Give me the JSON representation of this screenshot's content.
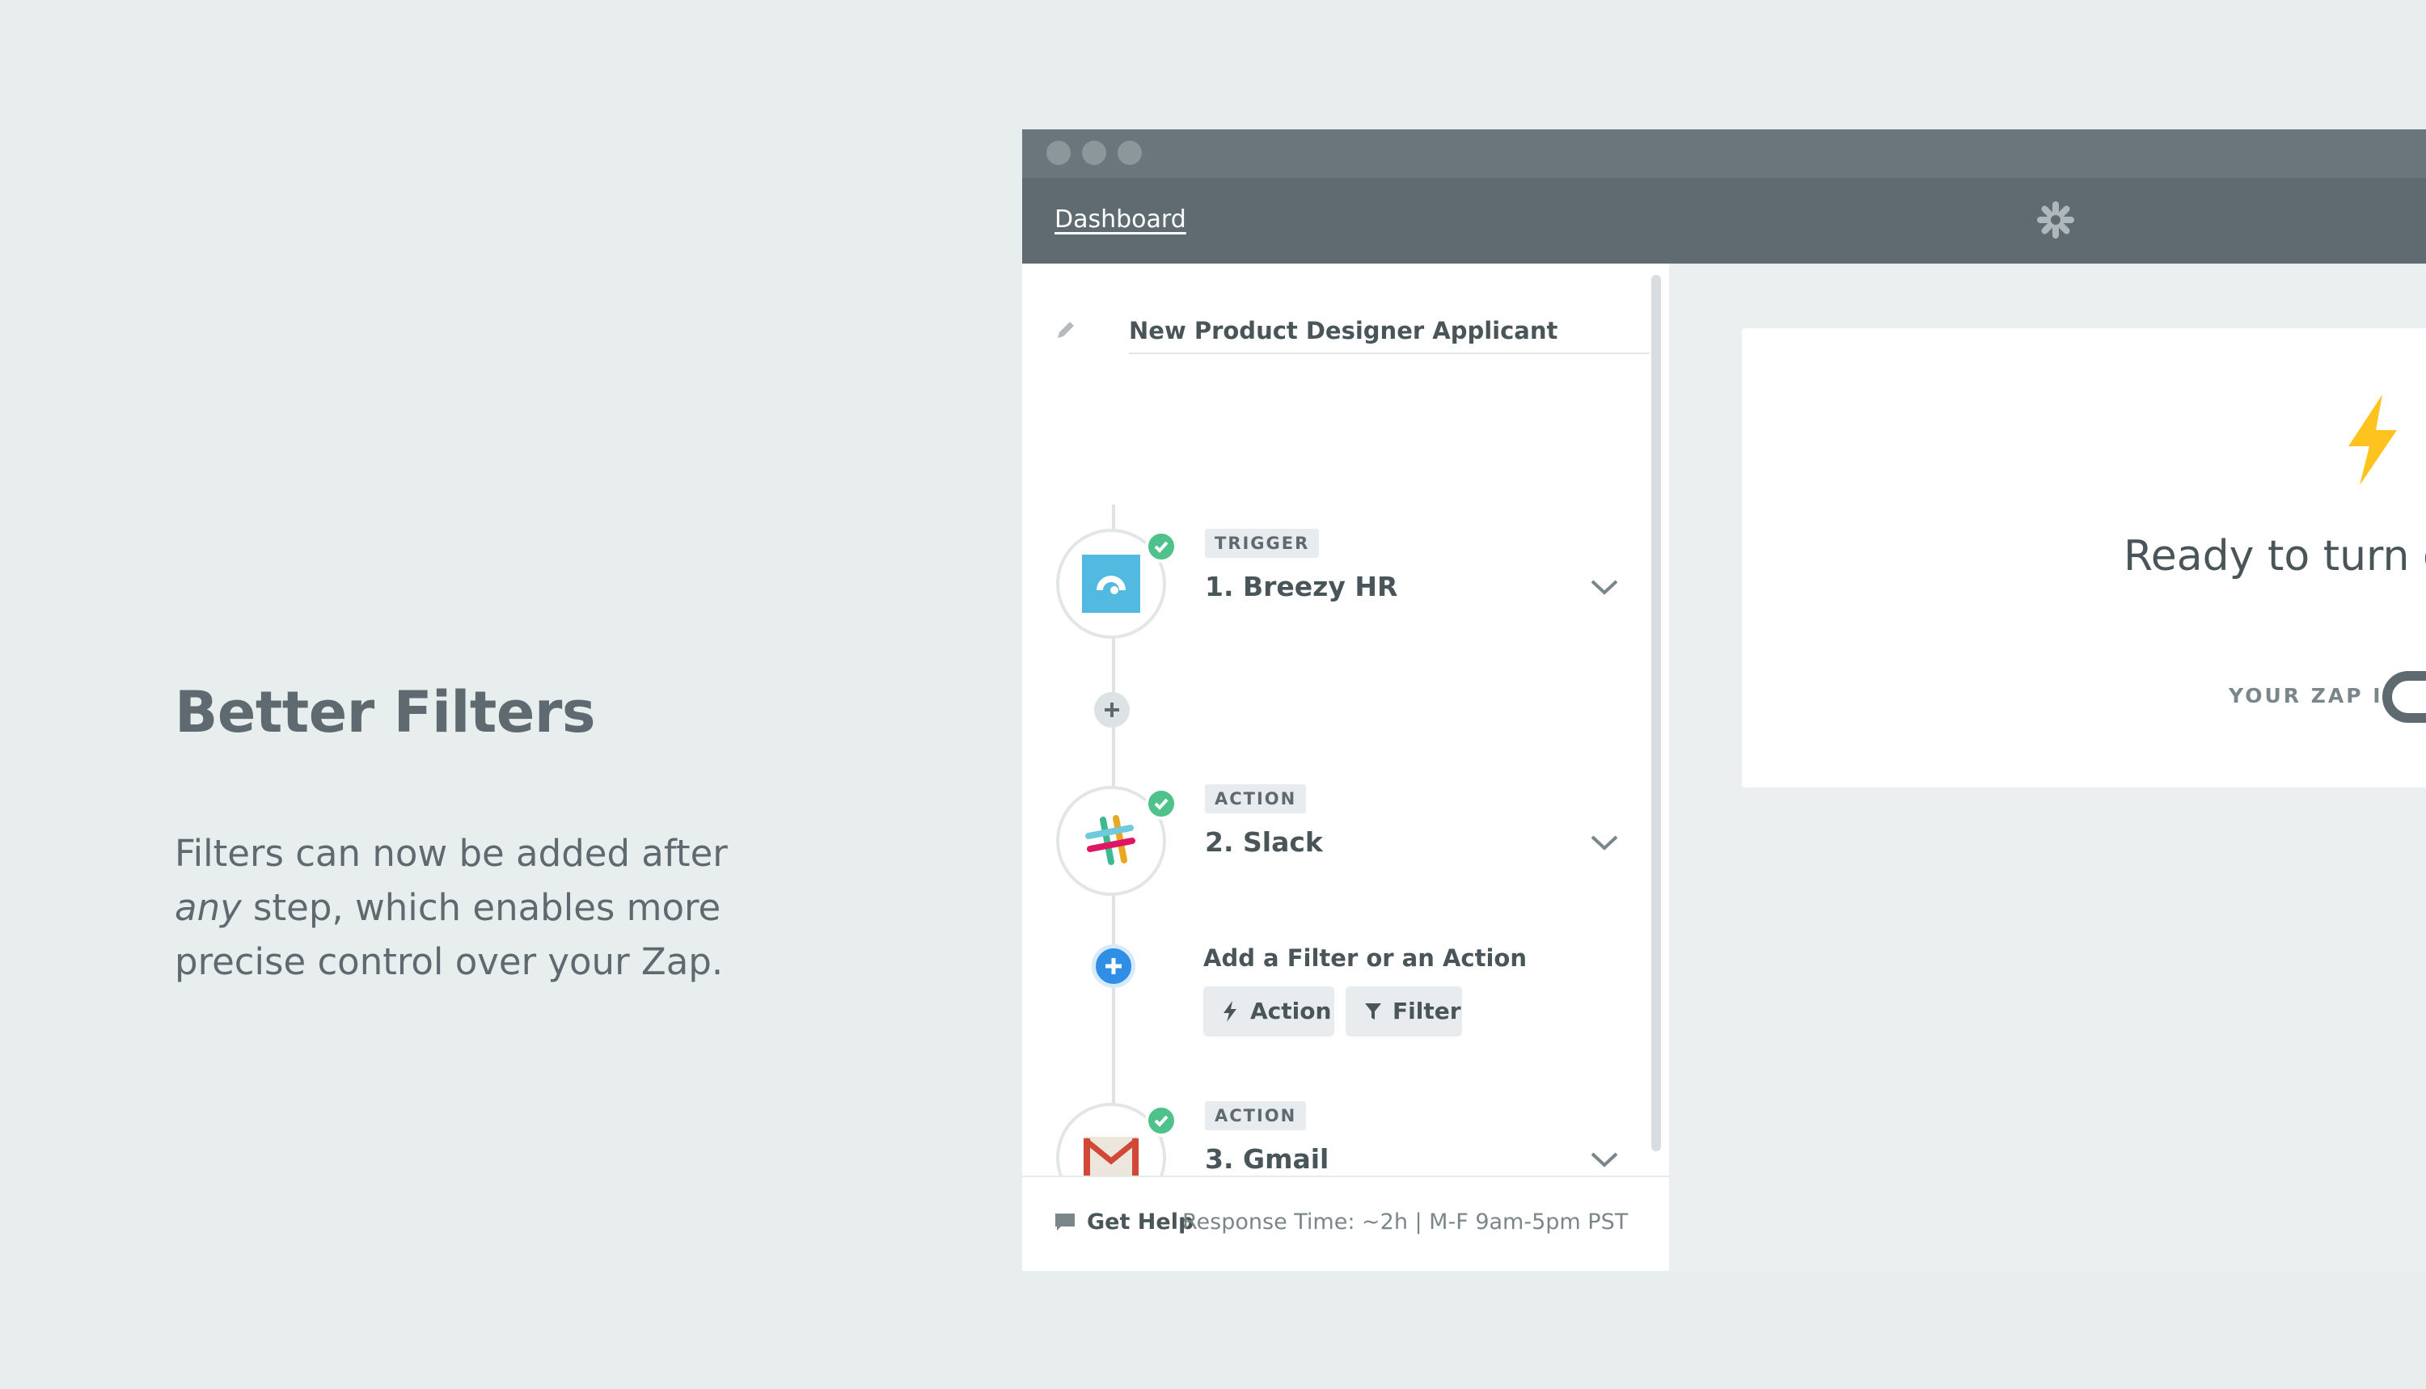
{
  "promo": {
    "title": "Better Filters",
    "body_part1": "Filters can now be added after ",
    "body_emphasis": "any",
    "body_part2": " step, which enables more precise control over your Zap."
  },
  "nav": {
    "dashboard_label": "Dashboard",
    "logo_icon": "zapier-asterisk-icon"
  },
  "editor": {
    "zap_name": "New Product Designer Applicant",
    "steps": [
      {
        "tag": "TRIGGER",
        "title": "1. Breezy HR",
        "app_icon": "breezy-hr-icon"
      },
      {
        "tag": "ACTION",
        "title": "2. Slack",
        "app_icon": "slack-icon"
      },
      {
        "tag": "ACTION",
        "title": "3. Gmail",
        "app_icon": "gmail-icon"
      }
    ],
    "add_prompt": "Add a Filter or an Action",
    "action_label": "Action",
    "filter_label": "Filter"
  },
  "footer": {
    "help_label": "Get Help",
    "help_detail": "Response Time: ~2h | M-F 9am-5pm PST"
  },
  "card": {
    "ready_text": "Ready to turn on",
    "zap_is_label": "YOUR ZAP IS"
  },
  "colors": {
    "background": "#e8eded",
    "chrome": "#5f6b71",
    "success_green": "#4ec28a",
    "add_blue": "#2f8ee5",
    "bolt_yellow": "#ffc31f",
    "text_dark": "#4a555a"
  }
}
